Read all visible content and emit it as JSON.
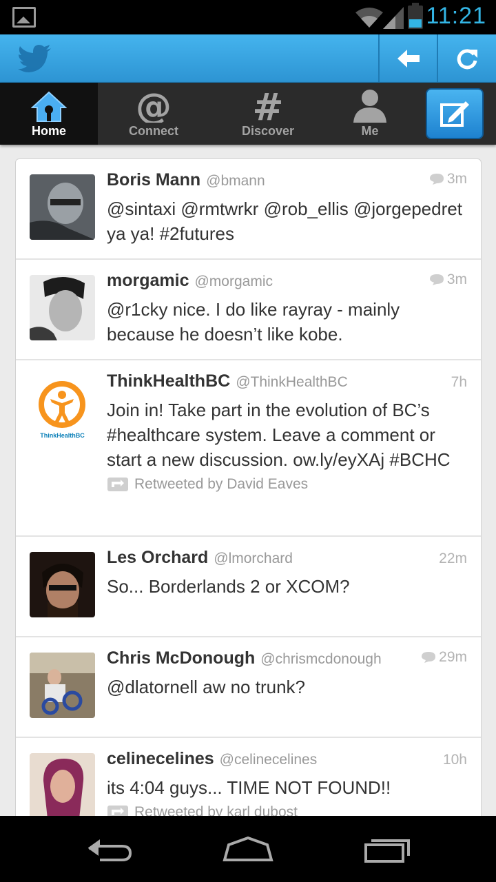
{
  "status_bar": {
    "time": "11:21",
    "icons": [
      "picture-icon",
      "wifi-icon",
      "signal-icon",
      "battery-icon"
    ],
    "accent": "#33b5e5"
  },
  "action_bar": {
    "logo": "twitter-bird-icon",
    "buttons": [
      "back-arrow-icon",
      "refresh-icon"
    ],
    "color": "#3aa6e4"
  },
  "tabs": [
    {
      "label": "Home",
      "icon": "home-icon",
      "active": true
    },
    {
      "label": "Connect",
      "icon": "at-icon",
      "active": false
    },
    {
      "label": "Discover",
      "icon": "hash-icon",
      "active": false
    },
    {
      "label": "Me",
      "icon": "person-icon",
      "active": false
    }
  ],
  "compose_icon": "compose-icon",
  "tweets": [
    {
      "name": "Boris Mann",
      "handle": "@bmann",
      "time": "3m",
      "has_reply": true,
      "text": "@sintaxi @rmtwrkr @rob_ellis @jorgepedret ya ya! #2futures",
      "retweeted_by": ""
    },
    {
      "name": "morgamic",
      "handle": "@morgamic",
      "time": "3m",
      "has_reply": true,
      "text": "@r1cky nice. I do like rayray - mainly because he doesn’t like kobe.",
      "retweeted_by": ""
    },
    {
      "name": "ThinkHealthBC",
      "handle": "@ThinkHealthBC",
      "time": "7h",
      "has_reply": false,
      "text": "Join in! Take part in the evolution of BC’s #healthcare system. Leave a comment or start a new discussion. ow.ly/eyXAj #BCHC",
      "retweeted_by": "Retweeted by David Eaves",
      "logo_text": "ThinkHealthBC"
    },
    {
      "name": "Les Orchard",
      "handle": "@lmorchard",
      "time": "22m",
      "has_reply": false,
      "text": "So... Borderlands 2 or XCOM?",
      "retweeted_by": ""
    },
    {
      "name": "Chris McDonough",
      "handle": "@chrismcdonough",
      "time": "29m",
      "has_reply": true,
      "text": "@dlatornell aw no trunk?",
      "retweeted_by": ""
    },
    {
      "name": "celinecelines",
      "handle": "@celinecelines",
      "time": "10h",
      "has_reply": false,
      "text": "its 4:04 guys... TIME NOT FOUND!!",
      "retweeted_by": "Retweeted by karl dubost"
    }
  ],
  "nav_bar": {
    "buttons": [
      "back-icon",
      "home-nav-icon",
      "recent-apps-icon"
    ]
  }
}
